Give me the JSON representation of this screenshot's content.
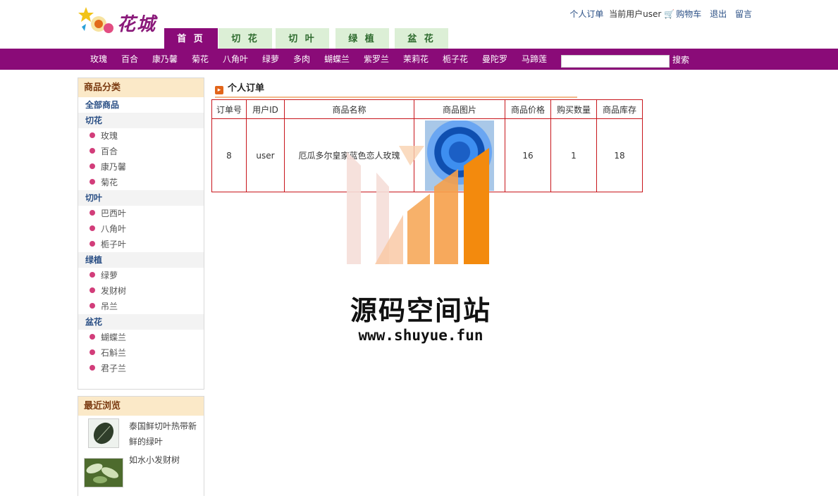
{
  "header": {
    "logo_text": "花城",
    "links": {
      "my_orders": "个人订单",
      "current_user": "当前用户user",
      "cart": "购物车",
      "logout": "退出",
      "message": "留言"
    }
  },
  "tabs": [
    "首 页",
    "切 花",
    "切 叶",
    "绿 植",
    "盆 花"
  ],
  "nav": {
    "items": [
      "玫瑰",
      "百合",
      "康乃馨",
      "菊花",
      "八角叶",
      "绿萝",
      "多肉",
      "蝴蝶兰",
      "紫罗兰",
      "茉莉花",
      "栀子花",
      "曼陀罗",
      "马蹄莲"
    ],
    "search_button": "搜索",
    "search_value": ""
  },
  "sidebar": {
    "category_title": "商品分类",
    "all_products": "全部商品",
    "groups": [
      {
        "name": "切花",
        "items": [
          "玫瑰",
          "百合",
          "康乃馨",
          "菊花"
        ]
      },
      {
        "name": "切叶",
        "items": [
          "巴西叶",
          "八角叶",
          "栀子叶"
        ]
      },
      {
        "name": "绿植",
        "items": [
          "绿萝",
          "发财树",
          "吊兰"
        ]
      },
      {
        "name": "盆花",
        "items": [
          "蝴蝶兰",
          "石斛兰",
          "君子兰"
        ]
      }
    ],
    "recent_title": "最近浏览",
    "recent": [
      "泰国鲜切叶热带新鲜的绿叶",
      "如水小发财树"
    ]
  },
  "main": {
    "title": "个人订单",
    "table": {
      "headers": [
        "订单号",
        "用户ID",
        "商品名称",
        "商品图片",
        "商品价格",
        "购买数量",
        "商品库存"
      ],
      "rows": [
        {
          "order_id": "8",
          "user_id": "user",
          "name": "厄瓜多尔皇家蓝色恋人玫瑰",
          "price": "16",
          "qty": "1",
          "stock": "18"
        }
      ]
    }
  },
  "watermark": {
    "title": "源码空间站",
    "url": "www.shuyue.fun"
  },
  "colors": {
    "brand_purple": "#8a0b78",
    "tab_green": "#dcefd6",
    "table_border": "#c8151b",
    "accent_orange": "#f38a0d"
  }
}
